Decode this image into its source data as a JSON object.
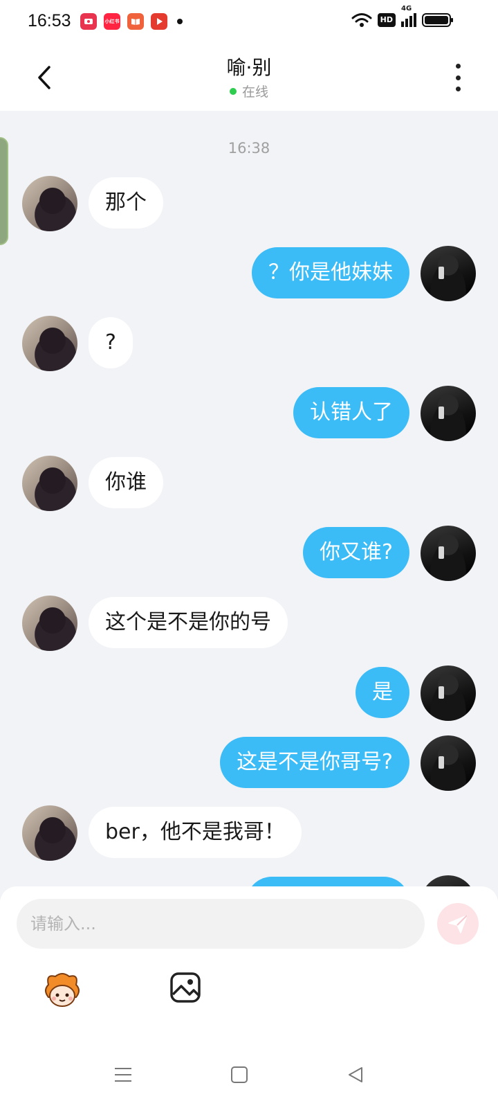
{
  "status_bar": {
    "time": "16:53",
    "hd_label": "HD",
    "network_label": "4G",
    "app_icons": [
      "video-app-icon",
      "xiaohongshu-app-icon",
      "book-app-icon",
      "play-app-icon"
    ],
    "app_icon_text": "小红书"
  },
  "header": {
    "title": "喻·别",
    "status": "在线",
    "status_color": "#2ecc4f"
  },
  "chat": {
    "timestamp": "16:38",
    "messages": [
      {
        "side": "other",
        "text": "那个"
      },
      {
        "side": "self",
        "text": "？你是他妹妹"
      },
      {
        "side": "other",
        "text": "?"
      },
      {
        "side": "self",
        "text": "认错人了"
      },
      {
        "side": "other",
        "text": "你谁"
      },
      {
        "side": "self",
        "text": "你又谁?"
      },
      {
        "side": "other",
        "text": "这个是不是你的号"
      },
      {
        "side": "self",
        "text": "是"
      },
      {
        "side": "self",
        "text": "这是不是你哥号?"
      },
      {
        "side": "other",
        "text": "ber，他不是我哥！"
      },
      {
        "side": "self",
        "text": ""
      }
    ]
  },
  "input": {
    "placeholder": "请输入..."
  },
  "colors": {
    "self_bubble": "#3bbcf7",
    "other_bubble": "#ffffff",
    "chat_background": "#f2f3f7",
    "send_button": "#fde3e6"
  }
}
